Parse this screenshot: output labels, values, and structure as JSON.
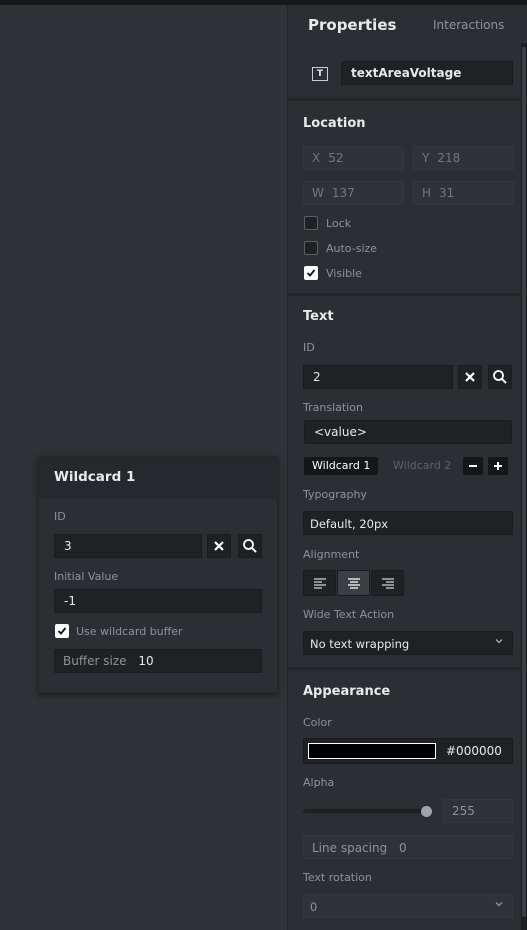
{
  "popup": {
    "title": "Wildcard 1",
    "id_label": "ID",
    "id_value": "3",
    "initial_value_label": "Initial Value",
    "initial_value": "-1",
    "use_buffer_label": "Use wildcard buffer",
    "use_buffer_checked": true,
    "buffer_size_label": "Buffer size",
    "buffer_size_value": "10"
  },
  "panel": {
    "tabs": {
      "properties": "Properties",
      "interactions": "Interactions"
    },
    "widget_name": "textAreaVoltage",
    "widget_icon": "text-area-icon",
    "location": {
      "title": "Location",
      "x_label": "X",
      "x_value": "52",
      "y_label": "Y",
      "y_value": "218",
      "w_label": "W",
      "w_value": "137",
      "h_label": "H",
      "h_value": "31",
      "lock_label": "Lock",
      "lock_checked": false,
      "autosize_label": "Auto-size",
      "autosize_checked": false,
      "visible_label": "Visible",
      "visible_checked": true
    },
    "text": {
      "title": "Text",
      "id_label": "ID",
      "id_value": "2",
      "translation_label": "Translation",
      "translation_value": "<value>",
      "wildcard1": "Wildcard 1",
      "wildcard2": "Wildcard 2",
      "typography_label": "Typography",
      "typography_value": "Default, 20px",
      "alignment_label": "Alignment",
      "alignment_selected": "center",
      "wide_text_label": "Wide Text Action",
      "wide_text_value": "No text wrapping"
    },
    "appearance": {
      "title": "Appearance",
      "color_label": "Color",
      "color_hex": "#000000",
      "alpha_label": "Alpha",
      "alpha_value": "255",
      "alpha_fraction": 1.0,
      "line_spacing_label": "Line spacing",
      "line_spacing_value": "0",
      "rotation_label": "Text rotation",
      "rotation_value": "0"
    }
  }
}
